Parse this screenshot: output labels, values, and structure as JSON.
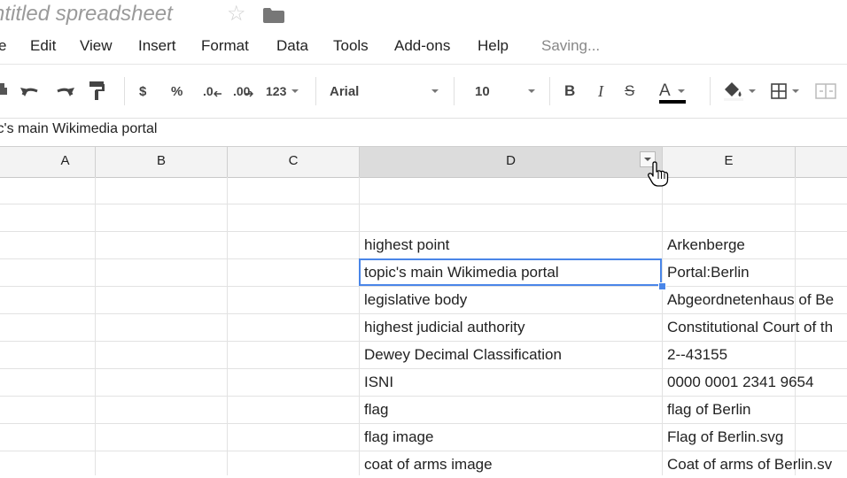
{
  "window": {
    "title": "ntitled spreadsheet",
    "star_icon": "star-icon",
    "folder_icon": "folder-icon"
  },
  "menu": {
    "items": [
      "e",
      "Edit",
      "View",
      "Insert",
      "Format",
      "Data",
      "Tools",
      "Add-ons",
      "Help"
    ],
    "status": "Saving..."
  },
  "toolbar": {
    "currency": "$",
    "percent": "%",
    "decrease_decimals": ".0",
    "increase_decimals": ".00",
    "more_formats": "123",
    "font": "Arial",
    "font_size": "10",
    "bold": "B",
    "italic": "I",
    "strikethrough": "S",
    "text_color": "A",
    "text_color_value": "#000000"
  },
  "formula_bar": {
    "content": "ic's main Wikimedia portal"
  },
  "grid": {
    "columns": [
      "A",
      "B",
      "C",
      "D",
      "E"
    ],
    "selected_column": "D",
    "selected_cell_color": "#4a86e8",
    "rows": [
      {
        "d": "",
        "e": ""
      },
      {
        "d": "",
        "e": ""
      },
      {
        "d": "highest point",
        "e": "Arkenberge"
      },
      {
        "d": "topic's main Wikimedia portal",
        "e": "Portal:Berlin"
      },
      {
        "d": "legislative body",
        "e": "Abgeordnetenhaus of Be"
      },
      {
        "d": "highest judicial authority",
        "e": "Constitutional Court of th"
      },
      {
        "d": "Dewey Decimal Classification",
        "e": "2--43155"
      },
      {
        "d": "ISNI",
        "e": "0000 0001 2341 9654"
      },
      {
        "d": "flag",
        "e": "flag of Berlin"
      },
      {
        "d": "flag image",
        "e": "Flag of Berlin.svg"
      },
      {
        "d": "coat of arms image",
        "e": "Coat of arms of Berlin.sv"
      }
    ]
  }
}
